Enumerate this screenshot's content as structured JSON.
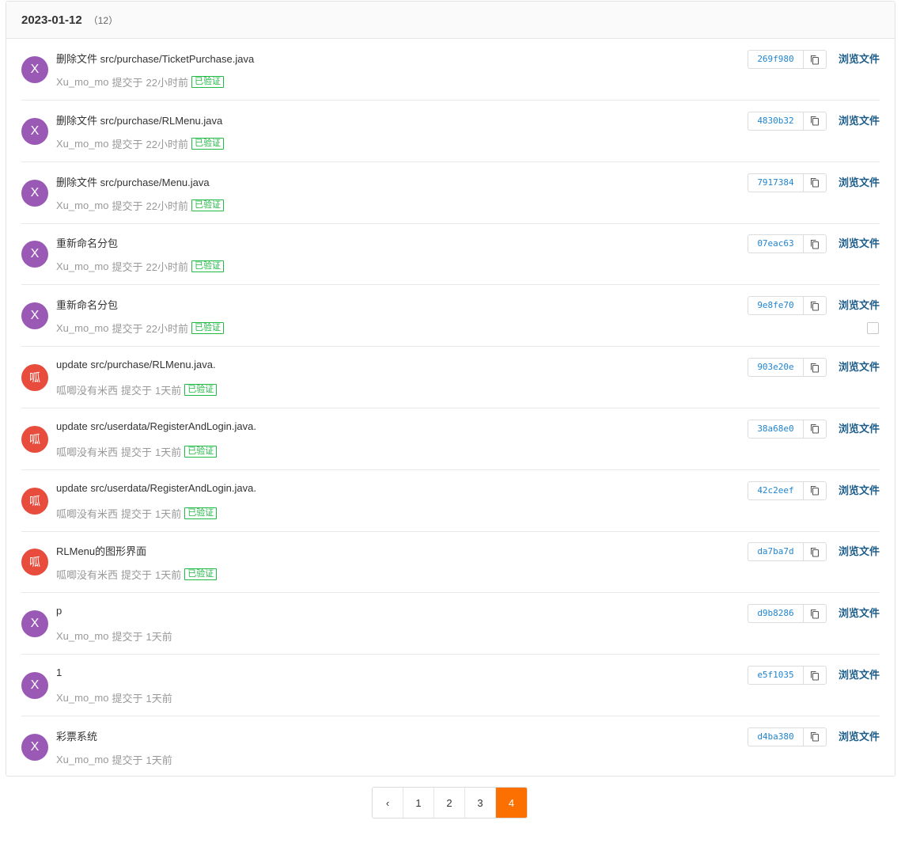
{
  "header": {
    "date": "2023-01-12",
    "count": "（12）"
  },
  "commits": [
    {
      "avatar": "X",
      "avatar_color": "purple",
      "message": "删除文件 src/purchase/TicketPurchase.java",
      "author": "Xu_mo_mo",
      "action": "提交于",
      "time": "22小时前",
      "verified": "已验证",
      "sha": "269f980",
      "browse": "浏览文件"
    },
    {
      "avatar": "X",
      "avatar_color": "purple",
      "message": "删除文件 src/purchase/RLMenu.java",
      "author": "Xu_mo_mo",
      "action": "提交于",
      "time": "22小时前",
      "verified": "已验证",
      "sha": "4830b32",
      "browse": "浏览文件"
    },
    {
      "avatar": "X",
      "avatar_color": "purple",
      "message": "删除文件 src/purchase/Menu.java",
      "author": "Xu_mo_mo",
      "action": "提交于",
      "time": "22小时前",
      "verified": "已验证",
      "sha": "7917384",
      "browse": "浏览文件"
    },
    {
      "avatar": "X",
      "avatar_color": "purple",
      "message": "重新命名分包",
      "author": "Xu_mo_mo",
      "action": "提交于",
      "time": "22小时前",
      "verified": "已验证",
      "sha": "07eac63",
      "browse": "浏览文件"
    },
    {
      "avatar": "X",
      "avatar_color": "purple",
      "message": "重新命名分包",
      "author": "Xu_mo_mo",
      "action": "提交于",
      "time": "22小时前",
      "verified": "已验证",
      "sha": "9e8fe70",
      "browse": "浏览文件",
      "checkbox": true
    },
    {
      "avatar": "呱",
      "avatar_color": "red",
      "message": "update src/purchase/RLMenu.java.",
      "author": "呱唧没有米西",
      "action": "提交于",
      "time": "1天前",
      "verified": "已验证",
      "sha": "903e20e",
      "browse": "浏览文件"
    },
    {
      "avatar": "呱",
      "avatar_color": "red",
      "message": "update src/userdata/RegisterAndLogin.java.",
      "author": "呱唧没有米西",
      "action": "提交于",
      "time": "1天前",
      "verified": "已验证",
      "sha": "38a68e0",
      "browse": "浏览文件"
    },
    {
      "avatar": "呱",
      "avatar_color": "red",
      "message": "update src/userdata/RegisterAndLogin.java.",
      "author": "呱唧没有米西",
      "action": "提交于",
      "time": "1天前",
      "verified": "已验证",
      "sha": "42c2eef",
      "browse": "浏览文件"
    },
    {
      "avatar": "呱",
      "avatar_color": "red",
      "message": "RLMenu的图形界面",
      "author": "呱唧没有米西",
      "action": "提交于",
      "time": "1天前",
      "verified": "已验证",
      "sha": "da7ba7d",
      "browse": "浏览文件"
    },
    {
      "avatar": "X",
      "avatar_color": "purple",
      "message": "p",
      "author": "Xu_mo_mo",
      "action": "提交于",
      "time": "1天前",
      "verified": "",
      "sha": "d9b8286",
      "browse": "浏览文件"
    },
    {
      "avatar": "X",
      "avatar_color": "purple",
      "message": "1",
      "author": "Xu_mo_mo",
      "action": "提交于",
      "time": "1天前",
      "verified": "",
      "sha": "e5f1035",
      "browse": "浏览文件"
    },
    {
      "avatar": "X",
      "avatar_color": "purple",
      "message": "彩票系统",
      "author": "Xu_mo_mo",
      "action": "提交于",
      "time": "1天前",
      "verified": "",
      "sha": "d4ba380",
      "browse": "浏览文件"
    }
  ],
  "pagination": {
    "prev": "‹",
    "pages": [
      "1",
      "2",
      "3",
      "4"
    ],
    "current": "4"
  },
  "colors": {
    "accent": "#fb7000",
    "sha": "#2185d0",
    "link": "#1d5d8a",
    "verified": "#21ba45"
  }
}
